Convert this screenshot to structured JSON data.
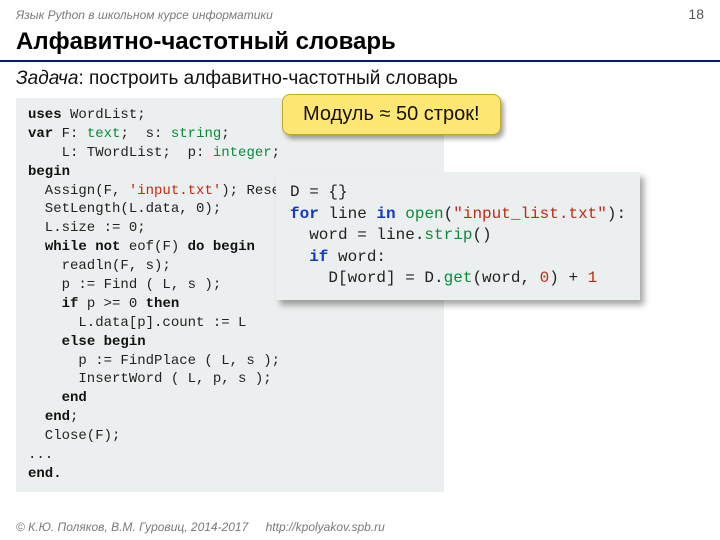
{
  "header": {
    "course": "Язык Python в школьном курсе информатики",
    "page": "18"
  },
  "title": "Алфавитно-частотный словарь",
  "task": {
    "label": "Задача",
    "text": ": построить алфавитно-частотный словарь"
  },
  "callout": "Модуль ≈ 50 строк!",
  "pascal": {
    "l1a": "uses",
    "l1b": " WordList;",
    "l2a": "var",
    "l2b": " F: ",
    "l2c": "text",
    "l2d": ";  s: ",
    "l2e": "string",
    "l2f": ";",
    "l3a": "    L: TWordList;  p: ",
    "l3b": "integer",
    "l3c": ";",
    "l4": "begin",
    "l5a": "  Assign(F, ",
    "l5b": "'input.txt'",
    "l5c": "); Reset(F);",
    "l6": "  SetLength(L.data, 0);",
    "l7": "  L.size := 0;",
    "l8a": "  ",
    "l8b": "while not",
    "l8c": " eof(F) ",
    "l8d": "do begin",
    "l9": "    readln(F, s);",
    "l10": "    p := Find ( L, s );",
    "l11a": "    ",
    "l11b": "if",
    "l11c": " p >= 0 ",
    "l11d": "then",
    "l12": "      L.data[p].count := L",
    "l13a": "    ",
    "l13b": "else begin",
    "l14": "      p := FindPlace ( L, s );",
    "l15": "      InsertWord ( L, p, s );",
    "l16a": "    ",
    "l16b": "end",
    "l17a": "  ",
    "l17b": "end",
    "l17c": ";",
    "l18": "  Close(F);",
    "l19": "...",
    "l20": "end."
  },
  "python": {
    "l1": "D = {}",
    "l2a": "for",
    "l2b": " line ",
    "l2c": "in",
    "l2d": " ",
    "l2e": "open",
    "l2f": "(",
    "l2g": "\"input_list.txt\"",
    "l2h": "):",
    "l3a": "  word = line.",
    "l3b": "strip",
    "l3c": "()",
    "l4a": "  ",
    "l4b": "if",
    "l4c": " word:",
    "l5a": "    D[word] = D.",
    "l5b": "get",
    "l5c": "(word, ",
    "l5d": "0",
    "l5e": ") + ",
    "l5f": "1"
  },
  "footer": {
    "copyright": "© К.Ю. Поляков, В.М. Гуровиц, 2014-2017",
    "url": "http://kpolyakov.spb.ru"
  }
}
